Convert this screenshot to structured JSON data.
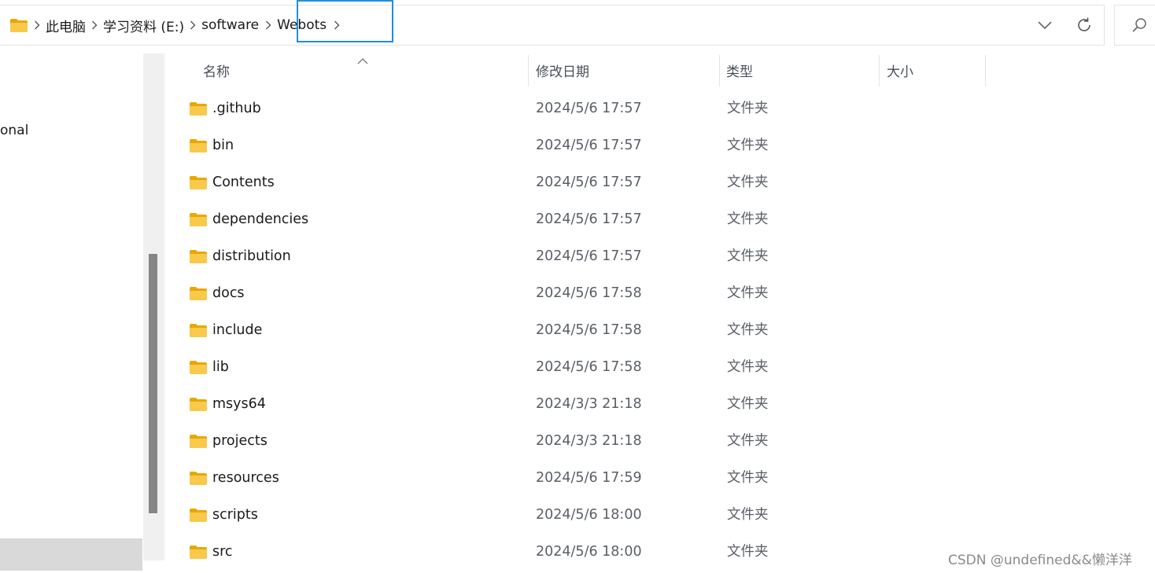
{
  "breadcrumb": {
    "items": [
      "此电脑",
      "学习资料 (E:)",
      "software",
      "Webots"
    ]
  },
  "nav": {
    "partial_label": "onal"
  },
  "columns": {
    "name": "名称",
    "modified": "修改日期",
    "type": "类型",
    "size": "大小"
  },
  "files": [
    {
      "name": ".github",
      "modified": "2024/5/6 17:57",
      "type": "文件夹"
    },
    {
      "name": "bin",
      "modified": "2024/5/6 17:57",
      "type": "文件夹"
    },
    {
      "name": "Contents",
      "modified": "2024/5/6 17:57",
      "type": "文件夹"
    },
    {
      "name": "dependencies",
      "modified": "2024/5/6 17:57",
      "type": "文件夹"
    },
    {
      "name": "distribution",
      "modified": "2024/5/6 17:57",
      "type": "文件夹"
    },
    {
      "name": "docs",
      "modified": "2024/5/6 17:58",
      "type": "文件夹"
    },
    {
      "name": "include",
      "modified": "2024/5/6 17:58",
      "type": "文件夹"
    },
    {
      "name": "lib",
      "modified": "2024/5/6 17:58",
      "type": "文件夹"
    },
    {
      "name": "msys64",
      "modified": "2024/3/3 21:18",
      "type": "文件夹"
    },
    {
      "name": "projects",
      "modified": "2024/3/3 21:18",
      "type": "文件夹"
    },
    {
      "name": "resources",
      "modified": "2024/5/6 17:59",
      "type": "文件夹"
    },
    {
      "name": "scripts",
      "modified": "2024/5/6 18:00",
      "type": "文件夹"
    },
    {
      "name": "src",
      "modified": "2024/5/6 18:00",
      "type": "文件夹"
    }
  ],
  "icons": {
    "folder": "folder-icon",
    "chevron": "chevron-right-icon",
    "dropdown": "chevron-down-icon",
    "refresh": "refresh-icon",
    "search": "search-icon",
    "sort": "sort-ascending-icon"
  },
  "colors": {
    "highlight_border": "#1e8fe0",
    "folder_yellow": "#f5c342",
    "selected_nav": "#d9d9d9"
  },
  "watermark": "CSDN @undefined&&懒洋洋"
}
